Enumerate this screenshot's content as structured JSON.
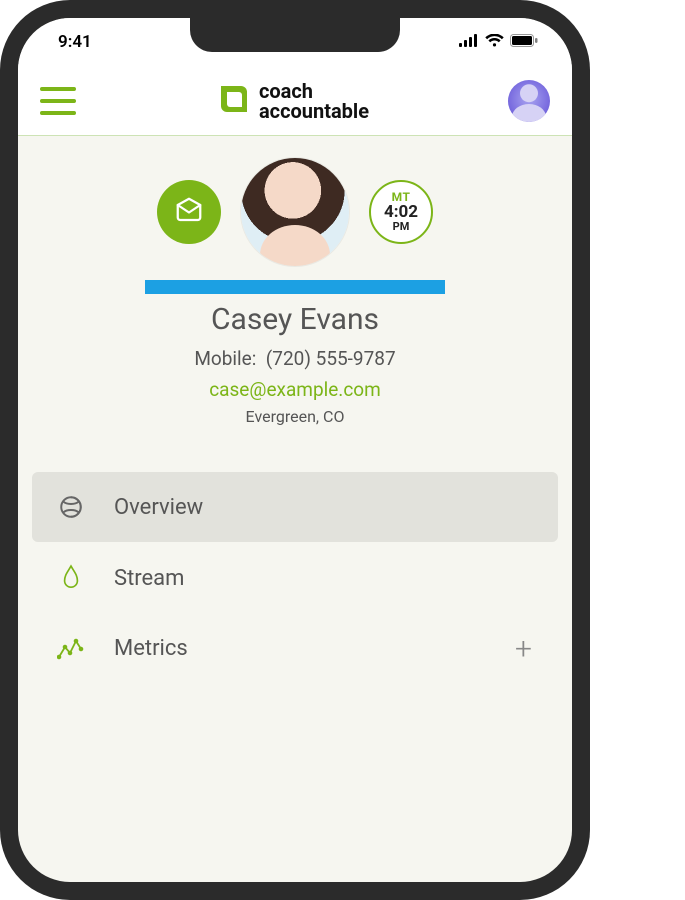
{
  "statusbar": {
    "time": "9:41"
  },
  "header": {
    "brand_line1": "coach",
    "brand_line2": "accountable"
  },
  "client": {
    "timezone_label": "MT",
    "timezone_time": "4:02",
    "timezone_ampm": "PM",
    "name": "Casey Evans",
    "phone_label": "Mobile:",
    "phone": "(720) 555-9787",
    "email": "case@example.com",
    "location": "Evergreen, CO"
  },
  "nav": {
    "items": [
      {
        "label": "Overview",
        "active": true,
        "has_add": false
      },
      {
        "label": "Stream",
        "active": false,
        "has_add": false
      },
      {
        "label": "Metrics",
        "active": false,
        "has_add": true
      }
    ]
  }
}
